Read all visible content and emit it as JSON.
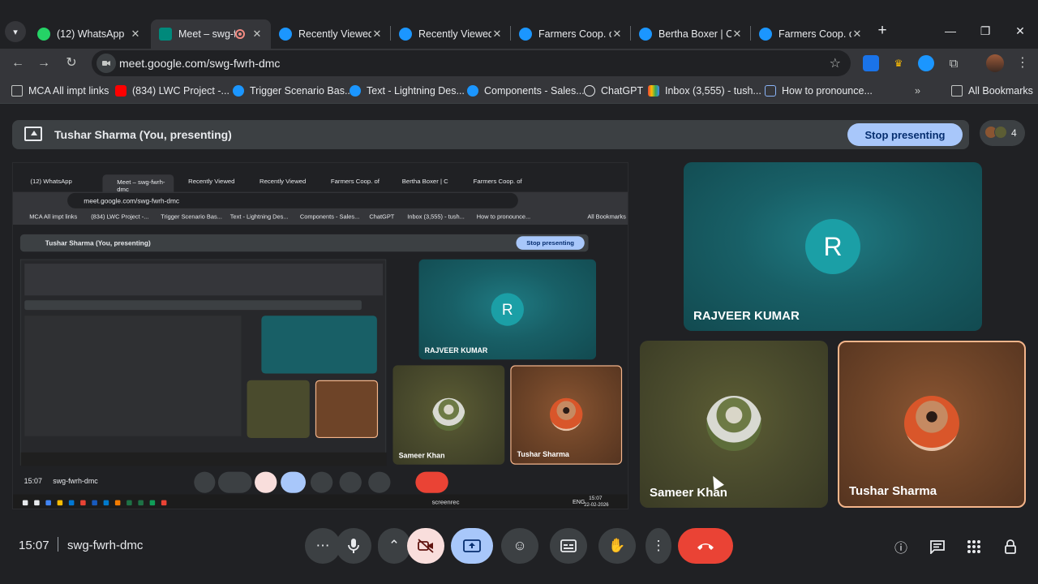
{
  "browser": {
    "tabs": [
      {
        "label": "(12) WhatsApp",
        "fav_color": "#25d366",
        "active": false
      },
      {
        "label": "Meet – swg-fwrh-dmc",
        "fav_color": "#00897b",
        "active": true
      },
      {
        "label": "Recently Viewed",
        "fav_color": "#1b96ff",
        "active": false
      },
      {
        "label": "Recently Viewed",
        "fav_color": "#1b96ff",
        "active": false
      },
      {
        "label": "Farmers Coop. of",
        "fav_color": "#1b96ff",
        "active": false
      },
      {
        "label": "Bertha Boxer | C",
        "fav_color": "#1b96ff",
        "active": false
      },
      {
        "label": "Farmers Coop. of",
        "fav_color": "#1b96ff",
        "active": false
      }
    ],
    "url": "meet.google.com/swg-fwrh-dmc",
    "bookmarks": [
      {
        "label": "MCA All impt links",
        "icon": "folder-icon"
      },
      {
        "label": "(834) LWC Project -...",
        "icon": "youtube-icon"
      },
      {
        "label": "Trigger Scenario Bas...",
        "icon": "salesforce-icon"
      },
      {
        "label": "Text - Lightning Des...",
        "icon": "salesforce-icon"
      },
      {
        "label": "Components - Sales...",
        "icon": "salesforce-icon"
      },
      {
        "label": "ChatGPT",
        "icon": "chatgpt-icon"
      },
      {
        "label": "Inbox (3,555) - tush...",
        "icon": "gmail-icon"
      },
      {
        "label": "How to pronounce...",
        "icon": "grid-icon"
      }
    ],
    "all_bookmarks": "All Bookmarks"
  },
  "meet": {
    "presenting_title": "Tushar Sharma (You, presenting)",
    "stop_presenting": "Stop presenting",
    "participant_count": "4",
    "clock": "15:07",
    "room": "swg-fwrh-dmc",
    "participants": {
      "rajveer": {
        "name": "RAJVEER KUMAR",
        "initial": "R"
      },
      "sameer": {
        "name": "Sameer Khan"
      },
      "tushar": {
        "name": "Tushar Sharma"
      }
    },
    "colors": {
      "stop_button": "#a8c7fa",
      "end_call": "#ea4335",
      "camera_off": "#f9dedc",
      "avatar_r": "#1b9fa6"
    }
  },
  "shared_screen": {
    "taskbar_screenrec": "screenrec",
    "taskbar_lang": "ENG",
    "taskbar_date": "22-02-2026",
    "taskbar_time": "15:07"
  }
}
